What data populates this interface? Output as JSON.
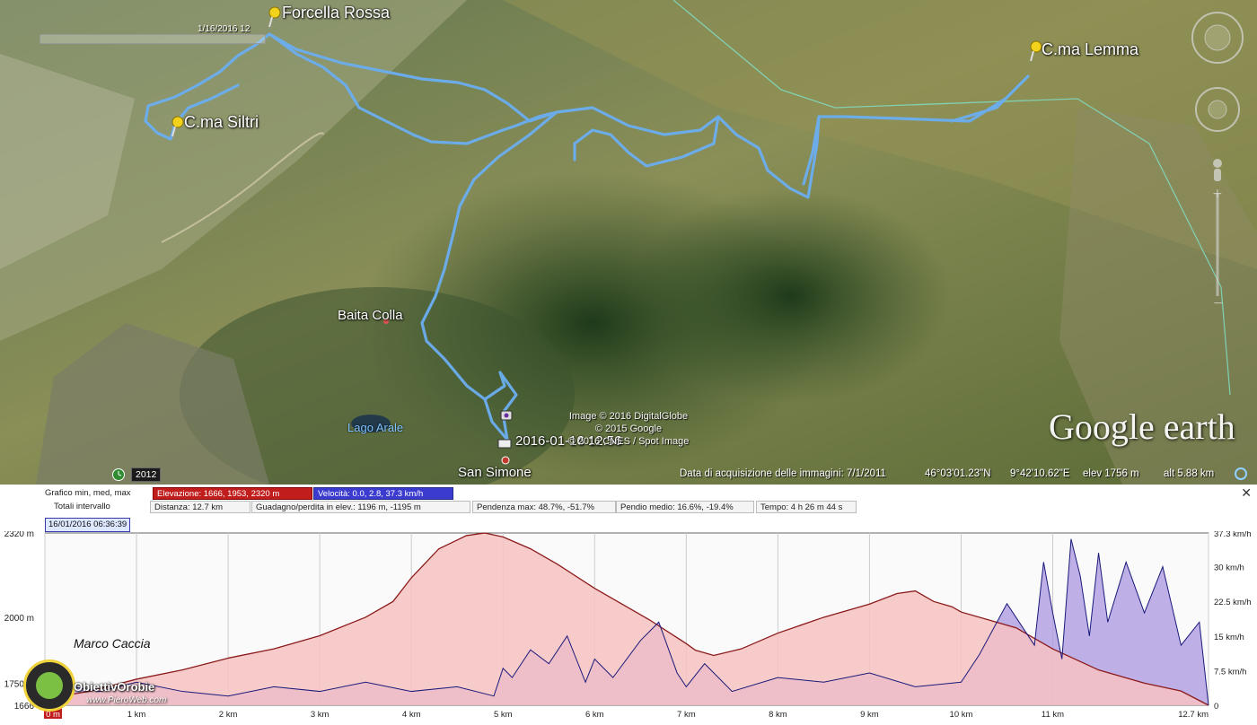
{
  "map": {
    "waypoints": [
      {
        "name": "Forcella Rossa"
      },
      {
        "name": "C.ma Lemma"
      },
      {
        "name": "C.ma Siltri"
      }
    ],
    "places": {
      "baita": "Baita Colla",
      "lago": "Lago Arale",
      "simone": "San Simone"
    },
    "track_label": "2016-01-16 12:56",
    "time_slider_label": "1/16/2016  12",
    "imagery_year": "2012",
    "credits": [
      "Image © 2016 DigitalGlobe",
      "© 2015 Google",
      "© 2016 CNES / Spot Image"
    ],
    "logo": "Google earth",
    "status": {
      "acquisition": "Data di acquisizione delle immagini: 7/1/2011",
      "lat": "46°03'01.23\"N",
      "lon": "9°42'10.62\"E",
      "elev": "elev  1756 m",
      "alt": "alt   5.88 km"
    },
    "colors": {
      "track": "#6aaef0",
      "pin": "#f2d21b"
    }
  },
  "profile": {
    "info": {
      "row1_label": "Grafico  min, med, max",
      "elevazione": "Elevazione: 1666, 1953, 2320 m",
      "velocita": "Velocità: 0.0, 2.8, 37.3 km/h",
      "row2_label": "Totali intervallo",
      "distanza": "Distanza: 12.7 km",
      "guadagno": "Guadagno/perdita in elev.: 1196 m, -1195 m",
      "pendenza": "Pendenza max: 48.7%, -51.7%",
      "pendio": "Pendio medio: 16.6%, -19.4%",
      "tempo": "Tempo: 4 h 26 m 44 s"
    },
    "timestamp": "16/01/2016 06:36:39",
    "author": "Marco Caccia",
    "logo_name": "ObiettivOrobie",
    "logo_url": "www.PieroWeb.com",
    "colors": {
      "elevation_fill": "#f7c2c2",
      "elevation_line": "#8b1a1a",
      "speed_fill": "#a996e0",
      "speed_line": "#1a1a7a"
    }
  },
  "chart_data": {
    "type": "area",
    "x_unit": "km",
    "xlim": [
      0,
      12.7
    ],
    "x_ticks": [
      "0 m",
      "1 km",
      "2 km",
      "3 km",
      "4 km",
      "5 km",
      "6 km",
      "7 km",
      "8 km",
      "9 km",
      "10 km",
      "11 km",
      "12.7 km"
    ],
    "x_tick_values": [
      0,
      1,
      2,
      3,
      4,
      5,
      6,
      7,
      8,
      9,
      10,
      11,
      12.7
    ],
    "left_axis": {
      "ylim": [
        1666,
        2320
      ],
      "ticks": [
        "2320 m",
        "2000 m",
        "1750 m",
        "1666"
      ],
      "tick_values": [
        2320,
        2000,
        1750,
        1666
      ]
    },
    "right_axis": {
      "ylim": [
        0,
        37.3
      ],
      "ticks": [
        "37.3 km/h",
        "30 km/h",
        "22.5 km/h",
        "15 km/h",
        "7.5 km/h",
        "0"
      ],
      "tick_values": [
        37.3,
        30,
        22.5,
        15,
        7.5,
        0
      ]
    },
    "series": [
      {
        "name": "Elevazione",
        "axis": "left",
        "x": [
          0,
          0.5,
          1,
          1.5,
          2,
          2.5,
          3,
          3.5,
          3.8,
          4,
          4.3,
          4.6,
          4.8,
          5,
          5.3,
          5.6,
          6,
          6.3,
          6.6,
          7,
          7.1,
          7.3,
          7.6,
          8,
          8.5,
          9,
          9.3,
          9.5,
          9.7,
          9.9,
          10,
          10.3,
          10.6,
          11,
          11.5,
          12,
          12.4,
          12.7
        ],
        "values": [
          1690,
          1720,
          1765,
          1800,
          1845,
          1880,
          1930,
          2000,
          2060,
          2150,
          2260,
          2310,
          2320,
          2305,
          2260,
          2200,
          2110,
          2050,
          1990,
          1900,
          1875,
          1855,
          1880,
          1940,
          2000,
          2050,
          2090,
          2100,
          2060,
          2040,
          2020,
          1990,
          1960,
          1880,
          1800,
          1750,
          1720,
          1666
        ]
      },
      {
        "name": "Velocità",
        "axis": "right",
        "x": [
          0,
          0.3,
          0.6,
          1,
          1.5,
          2,
          2.5,
          3,
          3.5,
          4,
          4.5,
          4.9,
          5,
          5.1,
          5.3,
          5.5,
          5.7,
          5.9,
          6,
          6.2,
          6.5,
          6.7,
          6.9,
          7,
          7.2,
          7.5,
          8,
          8.5,
          9,
          9.5,
          10,
          10.2,
          10.5,
          10.8,
          10.9,
          11,
          11.1,
          11.2,
          11.3,
          11.4,
          11.5,
          11.6,
          11.8,
          12,
          12.2,
          12.4,
          12.6,
          12.7
        ],
        "values": [
          3,
          4,
          3,
          5,
          3,
          2,
          4,
          3,
          5,
          3,
          4,
          2,
          8,
          6,
          12,
          9,
          15,
          5,
          10,
          6,
          14,
          18,
          7,
          4,
          9,
          3,
          6,
          5,
          7,
          4,
          5,
          11,
          22,
          13,
          31,
          20,
          10,
          36,
          28,
          15,
          33,
          18,
          31,
          20,
          30,
          13,
          18,
          0
        ]
      }
    ]
  }
}
